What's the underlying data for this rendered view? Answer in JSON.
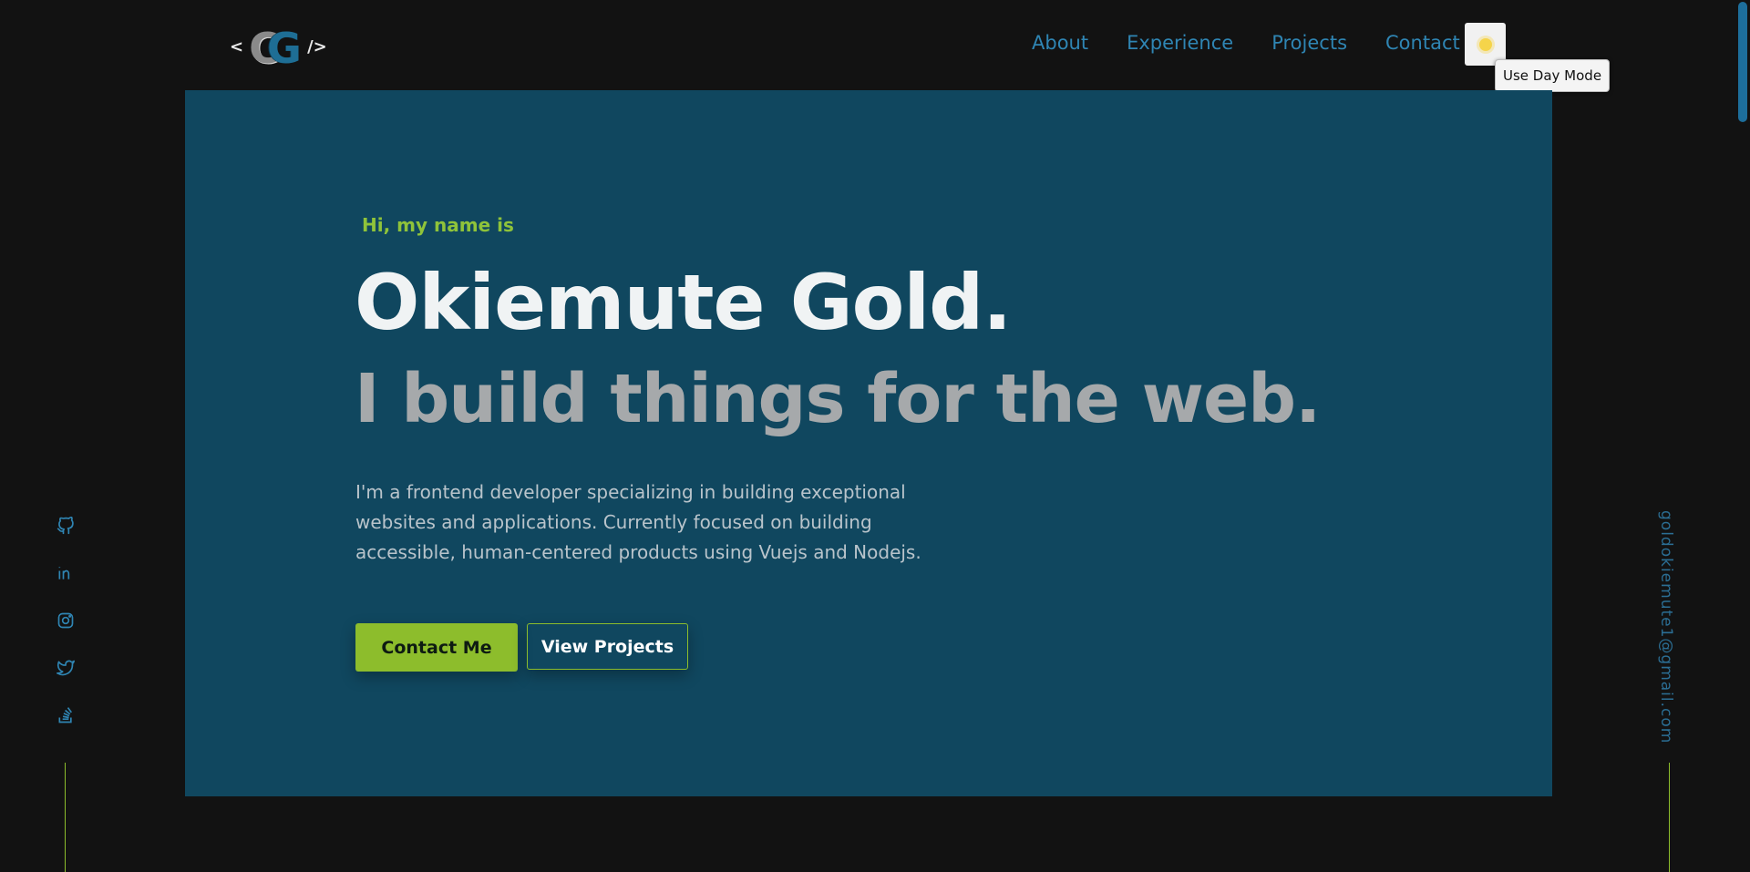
{
  "logo": {
    "left_bracket": "<",
    "letters_c": "C",
    "letters_g": "G",
    "right_bracket": "/>"
  },
  "nav": {
    "items": [
      "About",
      "Experience",
      "Projects",
      "Contact"
    ]
  },
  "theme_toggle": {
    "icon": "sun-icon",
    "tooltip": "Use Day Mode"
  },
  "hero": {
    "greeting": "Hi, my name is",
    "name": "Okiemute Gold.",
    "tagline": "I build things for the web.",
    "description": "I'm a frontend developer specializing in building exceptional websites and applications. Currently focused on building accessible, human-centered products using Vuejs and Nodejs.",
    "primary_button": "Contact Me",
    "secondary_button": "View Projects"
  },
  "socials": [
    "github-icon",
    "linkedin-icon",
    "instagram-icon",
    "twitter-icon",
    "stackoverflow-icon"
  ],
  "email": "goldokiemute1@gmail.com",
  "colors": {
    "accent": "#8dbd2c",
    "hero_bg": "#10475f",
    "link": "#2f85b3",
    "page_bg": "#121212"
  }
}
